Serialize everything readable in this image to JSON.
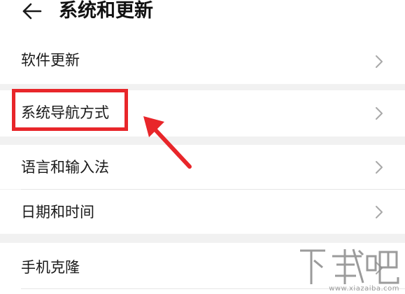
{
  "header": {
    "title": "系统和更新",
    "back_icon": "arrow-left-icon"
  },
  "settings": {
    "items": [
      {
        "label": "软件更新"
      },
      {
        "label": "系统导航方式"
      },
      {
        "label": "语言和输入法"
      },
      {
        "label": "日期和时间"
      },
      {
        "label": "手机克隆"
      }
    ]
  },
  "annotation": {
    "highlight_color": "#e8262a",
    "highlighted_item": "系统导航方式"
  },
  "watermark": {
    "logo_text": "下载吧",
    "url": "www.xiazaiba.com"
  }
}
